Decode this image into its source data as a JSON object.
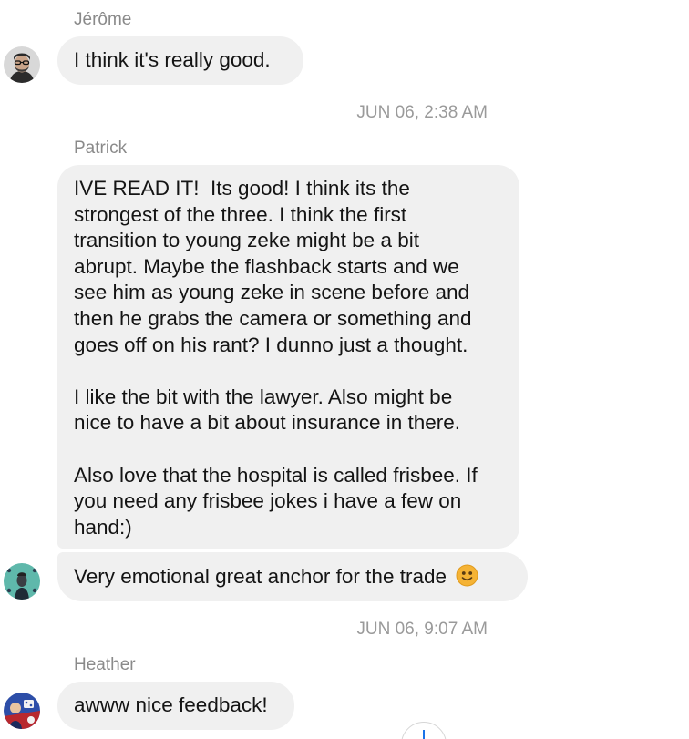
{
  "messages": [
    {
      "sender": "Jérôme",
      "lines": [
        "I think it's really good."
      ]
    },
    {
      "timestamp": "JUN 06, 2:38 AM"
    },
    {
      "sender": "Patrick",
      "lines": [
        "IVE READ IT!  Its good! I think its the",
        "strongest of the three. I think the first",
        "transition to young zeke might be a bit",
        "abrupt. Maybe the flashback starts and we",
        "see him as young zeke in scene before and",
        "then he grabs the camera or something and",
        "goes off on his rant? I dunno just a thought.",
        "",
        "I like the bit with the lawyer. Also might be",
        "nice to have a bit about insurance in there.",
        "",
        "Also love that the hospital is called frisbee. If",
        "you need any frisbee jokes i have a few on",
        "hand:)"
      ]
    },
    {
      "lines": [
        "Very emotional great anchor for the trade"
      ],
      "emoji": "slightly-smiling-face-icon"
    },
    {
      "timestamp": "JUN 06, 9:07 AM"
    },
    {
      "sender": "Heather",
      "lines": [
        "awww nice feedback!"
      ]
    }
  ],
  "colors": {
    "bubble": "#f0f0f0",
    "meta_text": "#8a8a8a",
    "emoji": "#f5b335"
  }
}
